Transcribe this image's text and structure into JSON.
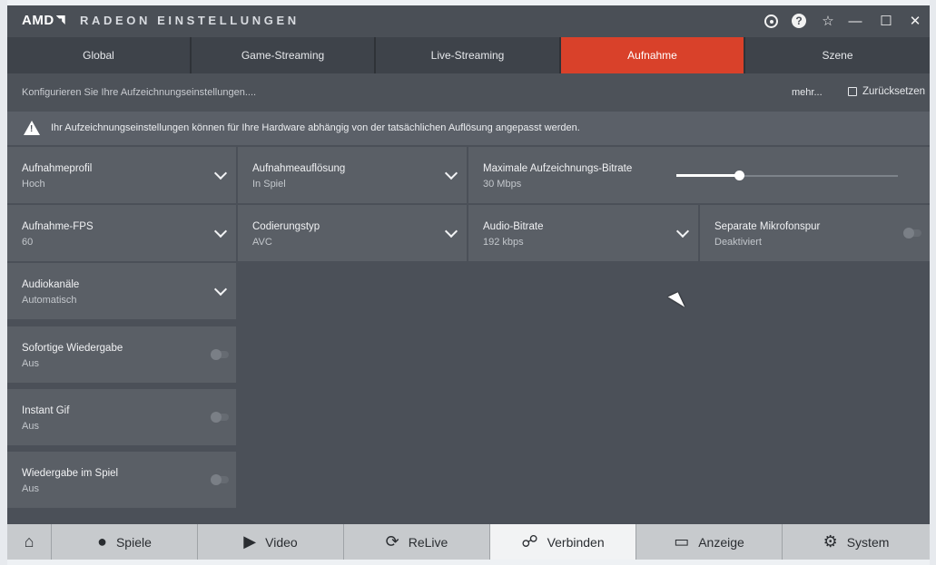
{
  "window": {
    "brand": "AMD",
    "title": "RADEON EINSTELLUNGEN"
  },
  "titlebar_icons": [
    "refresh-icon",
    "help-icon",
    "star-icon",
    "minimize-icon",
    "maximize-icon",
    "close-icon"
  ],
  "tabs": [
    {
      "label": "Global"
    },
    {
      "label": "Game-Streaming"
    },
    {
      "label": "Live-Streaming"
    },
    {
      "label": "Aufnahme",
      "active": true
    },
    {
      "label": "Szene"
    }
  ],
  "subbar": {
    "description": "Konfigurieren Sie Ihre Aufzeichnungseinstellungen....",
    "more": "mehr...",
    "reset": "Zurücksetzen"
  },
  "warning": "Ihr Aufzeichnungseinstellungen können für Ihre Hardware abhängig von der tatsächlichen Auflösung angepasst werden.",
  "settings": {
    "profile": {
      "label": "Aufnahmeprofil",
      "value": "Hoch"
    },
    "resolution": {
      "label": "Aufnahmeauflösung",
      "value": "In Spiel"
    },
    "bitrate": {
      "label": "Maximale Aufzeichnungs-Bitrate",
      "value": "30 Mbps",
      "level": 0.29
    },
    "fps": {
      "label": "Aufnahme-FPS",
      "value": "60"
    },
    "codec": {
      "label": "Codierungstyp",
      "value": "AVC"
    },
    "audio_bitrate": {
      "label": "Audio-Bitrate",
      "value": "192 kbps"
    },
    "mic_track": {
      "label": "Separate Mikrofonspur",
      "value": "Deaktiviert",
      "on": false
    },
    "channels": {
      "label": "Audiokanäle",
      "value": "Automatisch"
    },
    "instant_replay": {
      "label": "Sofortige Wiedergabe",
      "value": "Aus",
      "on": false
    },
    "instant_gif": {
      "label": "Instant Gif",
      "value": "Aus",
      "on": false
    },
    "ingame_replay": {
      "label": "Wiedergabe im Spiel",
      "value": "Aus",
      "on": false
    }
  },
  "bottom_nav": [
    {
      "label": "",
      "icon": "home-icon"
    },
    {
      "label": "Spiele",
      "icon": "gamepad-icon"
    },
    {
      "label": "Video",
      "icon": "play-icon"
    },
    {
      "label": "ReLive",
      "icon": "relive-icon"
    },
    {
      "label": "Verbinden",
      "icon": "connect-icon",
      "active": true
    },
    {
      "label": "Anzeige",
      "icon": "monitor-icon"
    },
    {
      "label": "System",
      "icon": "gear-icon"
    }
  ],
  "colors": {
    "accent": "#d9412a",
    "panel": "#4b5058",
    "tile": "#5a5f66"
  }
}
